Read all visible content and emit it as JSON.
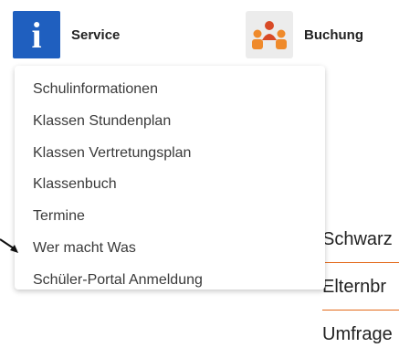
{
  "nav": {
    "service_label": "Service",
    "service_icon": "info-icon",
    "service_icon_glyph": "i",
    "buchung_label": "Buchung",
    "buchung_icon": "people-icon"
  },
  "menu": {
    "items": [
      "Schulinformationen",
      "Klassen Stundenplan",
      "Klassen Vertretungsplan",
      "Klassenbuch",
      "Termine",
      "Wer macht Was",
      "Schüler-Portal Anmeldung"
    ]
  },
  "background_list": {
    "items": [
      "Schwarz",
      "Elternbr",
      "Umfrage"
    ]
  },
  "colors": {
    "brand_blue": "#1f5fbf",
    "accent_orange": "#e36a1b",
    "person_red": "#d84a26",
    "person_orange": "#ef8a2b"
  }
}
